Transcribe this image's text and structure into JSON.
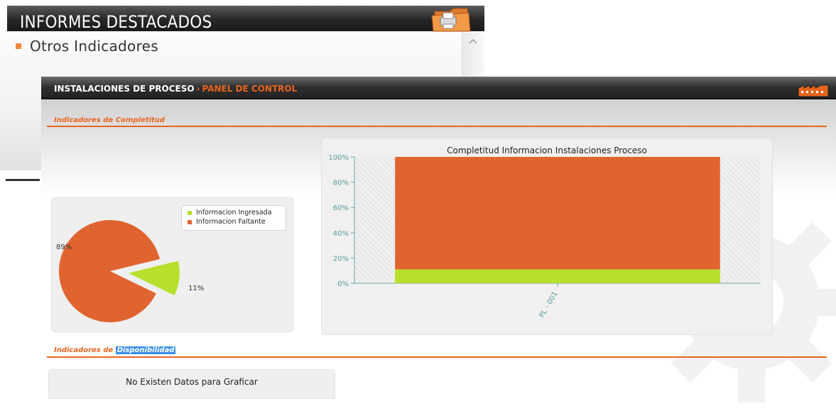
{
  "background_window": {
    "title": "INFORMES DESTACADOS",
    "item_label": "Otros Indicadores"
  },
  "panel": {
    "breadcrumb": {
      "root": "INSTALACIONES DE PROCESO",
      "separator": "›",
      "current": "PANEL DE CONTROL"
    },
    "section_completitud": "Indicadores de Completitud",
    "section_disponibilidad": {
      "prefix": "Indicadores de ",
      "highlighted": "Disponibilidad"
    },
    "no_data_message": "No Existen Datos para Graficar"
  },
  "colors": {
    "accent": "#e8651f",
    "pie_orange": "#e06430",
    "pie_green": "#b8df2c",
    "highlight": "#3a8ee6"
  },
  "chart_data": [
    {
      "type": "pie",
      "legend": [
        "Informacion Ingresada",
        "Informacion Faltante"
      ],
      "slices": [
        {
          "name": "Informacion Ingresada",
          "value": 11,
          "label": "11%",
          "color": "#b8df2c",
          "exploded": true
        },
        {
          "name": "Informacion Faltante",
          "value": 89,
          "label": "89%",
          "color": "#e06430"
        }
      ],
      "legend_position": "top-right"
    },
    {
      "type": "bar",
      "stacked": true,
      "title": "Completitud Informacion Instalaciones Proceso",
      "categories": [
        "PL - 001"
      ],
      "series": [
        {
          "name": "Informacion Ingresada",
          "values": [
            11
          ],
          "color": "#b8df2c"
        },
        {
          "name": "Informacion Faltante",
          "values": [
            89
          ],
          "color": "#e06430"
        }
      ],
      "yticks": [
        "0%",
        "20%",
        "40%",
        "60%",
        "80%",
        "100%"
      ],
      "ylim": [
        0,
        100
      ]
    }
  ]
}
